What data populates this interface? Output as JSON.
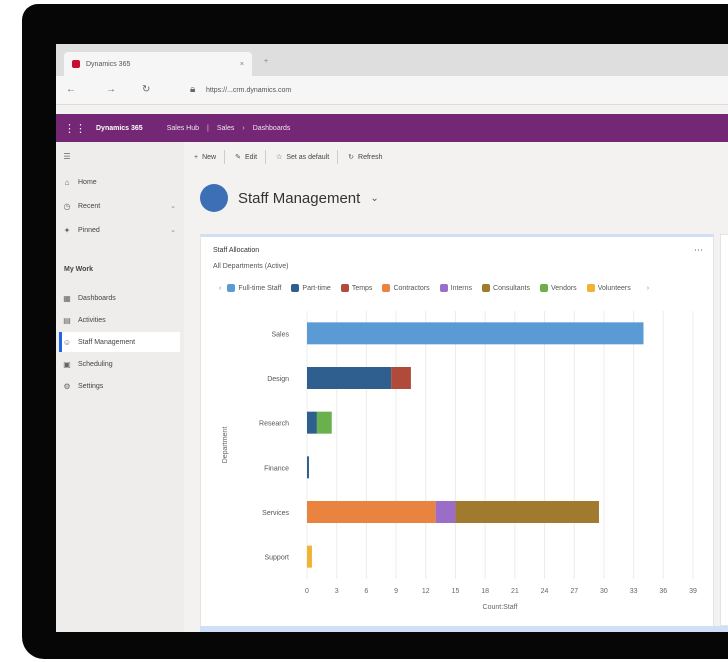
{
  "browser": {
    "tab_title": "Dynamics 365",
    "tab_close": "×",
    "new_tab": "+",
    "url": "https://...crm.dynamics.com"
  },
  "appbar": {
    "app_name": "Dynamics 365",
    "crumbs": [
      "Sales Hub",
      "Sales",
      "Dashboards"
    ],
    "colors": {
      "brand": "#742774"
    }
  },
  "sidebar": {
    "top_items": [
      {
        "label": "Home",
        "icon": "home-icon"
      },
      {
        "label": "Recent",
        "icon": "clock-icon"
      },
      {
        "label": "Pinned",
        "icon": "pin-icon"
      }
    ],
    "group_label": "My Work",
    "items": [
      {
        "label": "Dashboards",
        "icon": "dashboard-icon",
        "active": false
      },
      {
        "label": "Activities",
        "icon": "activity-icon",
        "active": false
      },
      {
        "label": "Staff Management",
        "icon": "people-icon",
        "active": true
      },
      {
        "label": "Scheduling",
        "icon": "calendar-icon",
        "active": false
      },
      {
        "label": "Settings",
        "icon": "gear-icon",
        "active": false
      }
    ]
  },
  "command_bar": {
    "items": [
      {
        "label": "New",
        "icon": "plus-icon"
      },
      {
        "label": "Edit",
        "icon": "edit-icon"
      },
      {
        "label": "Set as default",
        "icon": "star-icon"
      },
      {
        "label": "Refresh",
        "icon": "refresh-icon"
      }
    ]
  },
  "dashboard": {
    "title": "Staff Management",
    "caret": "⌄"
  },
  "card": {
    "header": "Staff Allocation",
    "subheader": "All Departments (Active)",
    "more": "⋯"
  },
  "chart_data": {
    "type": "bar",
    "orientation": "horizontal",
    "stacked": true,
    "categories": [
      "Sales",
      "Design",
      "Research",
      "Finance",
      "Services",
      "Support"
    ],
    "series": [
      {
        "name": "Full-time Staff",
        "color": "#5b9bd5",
        "values": [
          34,
          0,
          0,
          0,
          0,
          0
        ]
      },
      {
        "name": "Part-time",
        "color": "#2f5f8f",
        "values": [
          0,
          8.5,
          1,
          0.2,
          0,
          0
        ]
      },
      {
        "name": "Temps",
        "color": "#b04a3a",
        "values": [
          0,
          2,
          0,
          0,
          0,
          0
        ]
      },
      {
        "name": "Contractors",
        "color": "#e8843f",
        "values": [
          0,
          0,
          0,
          0,
          13,
          0
        ]
      },
      {
        "name": "Interns",
        "color": "#9b6dc6",
        "values": [
          0,
          0,
          0,
          0,
          2,
          0
        ]
      },
      {
        "name": "Consultants",
        "color": "#a07b2f",
        "values": [
          0,
          0,
          0,
          0,
          14.5,
          0
        ]
      },
      {
        "name": "Vendors",
        "color": "#6ab04c",
        "values": [
          0,
          0,
          1.5,
          0,
          0,
          0
        ]
      },
      {
        "name": "Volunteers",
        "color": "#f2b233",
        "values": [
          0,
          0,
          0,
          0,
          0,
          0.5
        ]
      }
    ],
    "x_ticks": [
      0,
      3,
      6,
      9,
      12,
      15,
      18,
      21,
      24,
      27,
      30,
      33,
      36,
      39
    ],
    "xlim": [
      0,
      39
    ],
    "xlabel": "Count:Staff",
    "ylabel": "Department",
    "grid": true,
    "legend": "top"
  }
}
